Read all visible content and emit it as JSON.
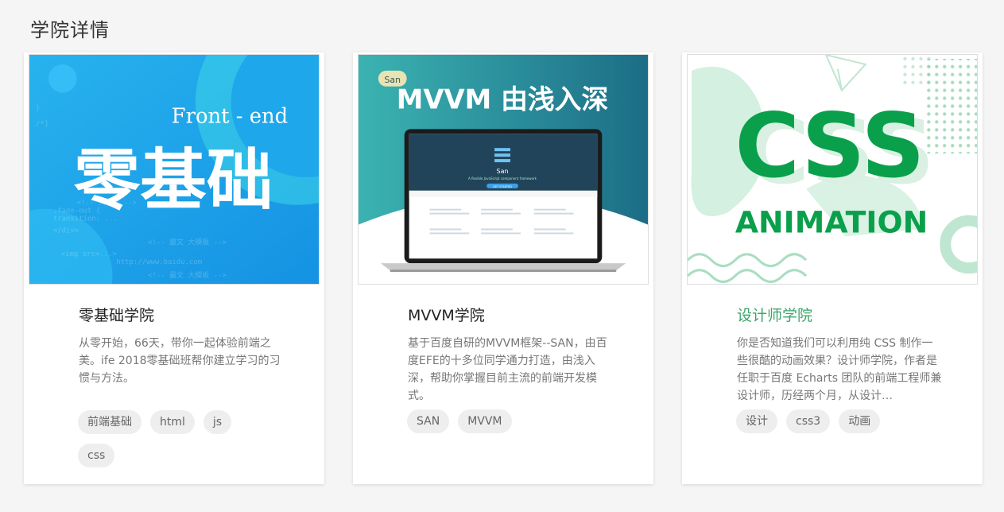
{
  "page": {
    "title": "学院详情"
  },
  "cards": [
    {
      "cover": {
        "subtitle": "Front - end",
        "headline": "零基础",
        "bg_color": "#1ea7ea",
        "code_lines": [
          "}",
          "/*]",
          "<!-- 大装盘 -->",
          ".fade-out {",
          "  transition: ...",
          "</div>",
          "<!-- 最文 大模板 -->",
          "<img src=...>",
          "http://www.baidu.com",
          "<!-- 最文 大模板 -->"
        ]
      },
      "title": "零基础学院",
      "description": "从零开始，66天，带你一起体验前端之美。ife 2018零基础班帮你建立学习的习惯与方法。",
      "tags": [
        "前端基础",
        "html",
        "js",
        "css"
      ]
    },
    {
      "cover": {
        "badge": "San",
        "headline": "MVVM 由浅入深",
        "screen_logo": "San",
        "screen_tagline": "A flexible JavaScript component framework",
        "screen_button": "GET STARTED",
        "bg_color": "#2a9b9f"
      },
      "title": "MVVM学院",
      "description": "基于百度自研的MVVM框架--SAN，由百度EFE的十多位同学通力打造，由浅入深，帮助你掌握目前主流的前端开发模式。",
      "tags": [
        "SAN",
        "MVVM"
      ]
    },
    {
      "cover": {
        "headline": "CSS",
        "subheadline": "ANIMATION",
        "accent_color": "#0aa04b"
      },
      "title": "设计师学院",
      "title_color": "#3aa56a",
      "description": "你是否知道我们可以利用纯 CSS 制作一些很酷的动画效果？设计师学院，作者是任职于百度 Echarts 团队的前端工程师兼设计师，历经两个月，从设计…",
      "tags": [
        "设计",
        "css3",
        "动画"
      ]
    }
  ]
}
